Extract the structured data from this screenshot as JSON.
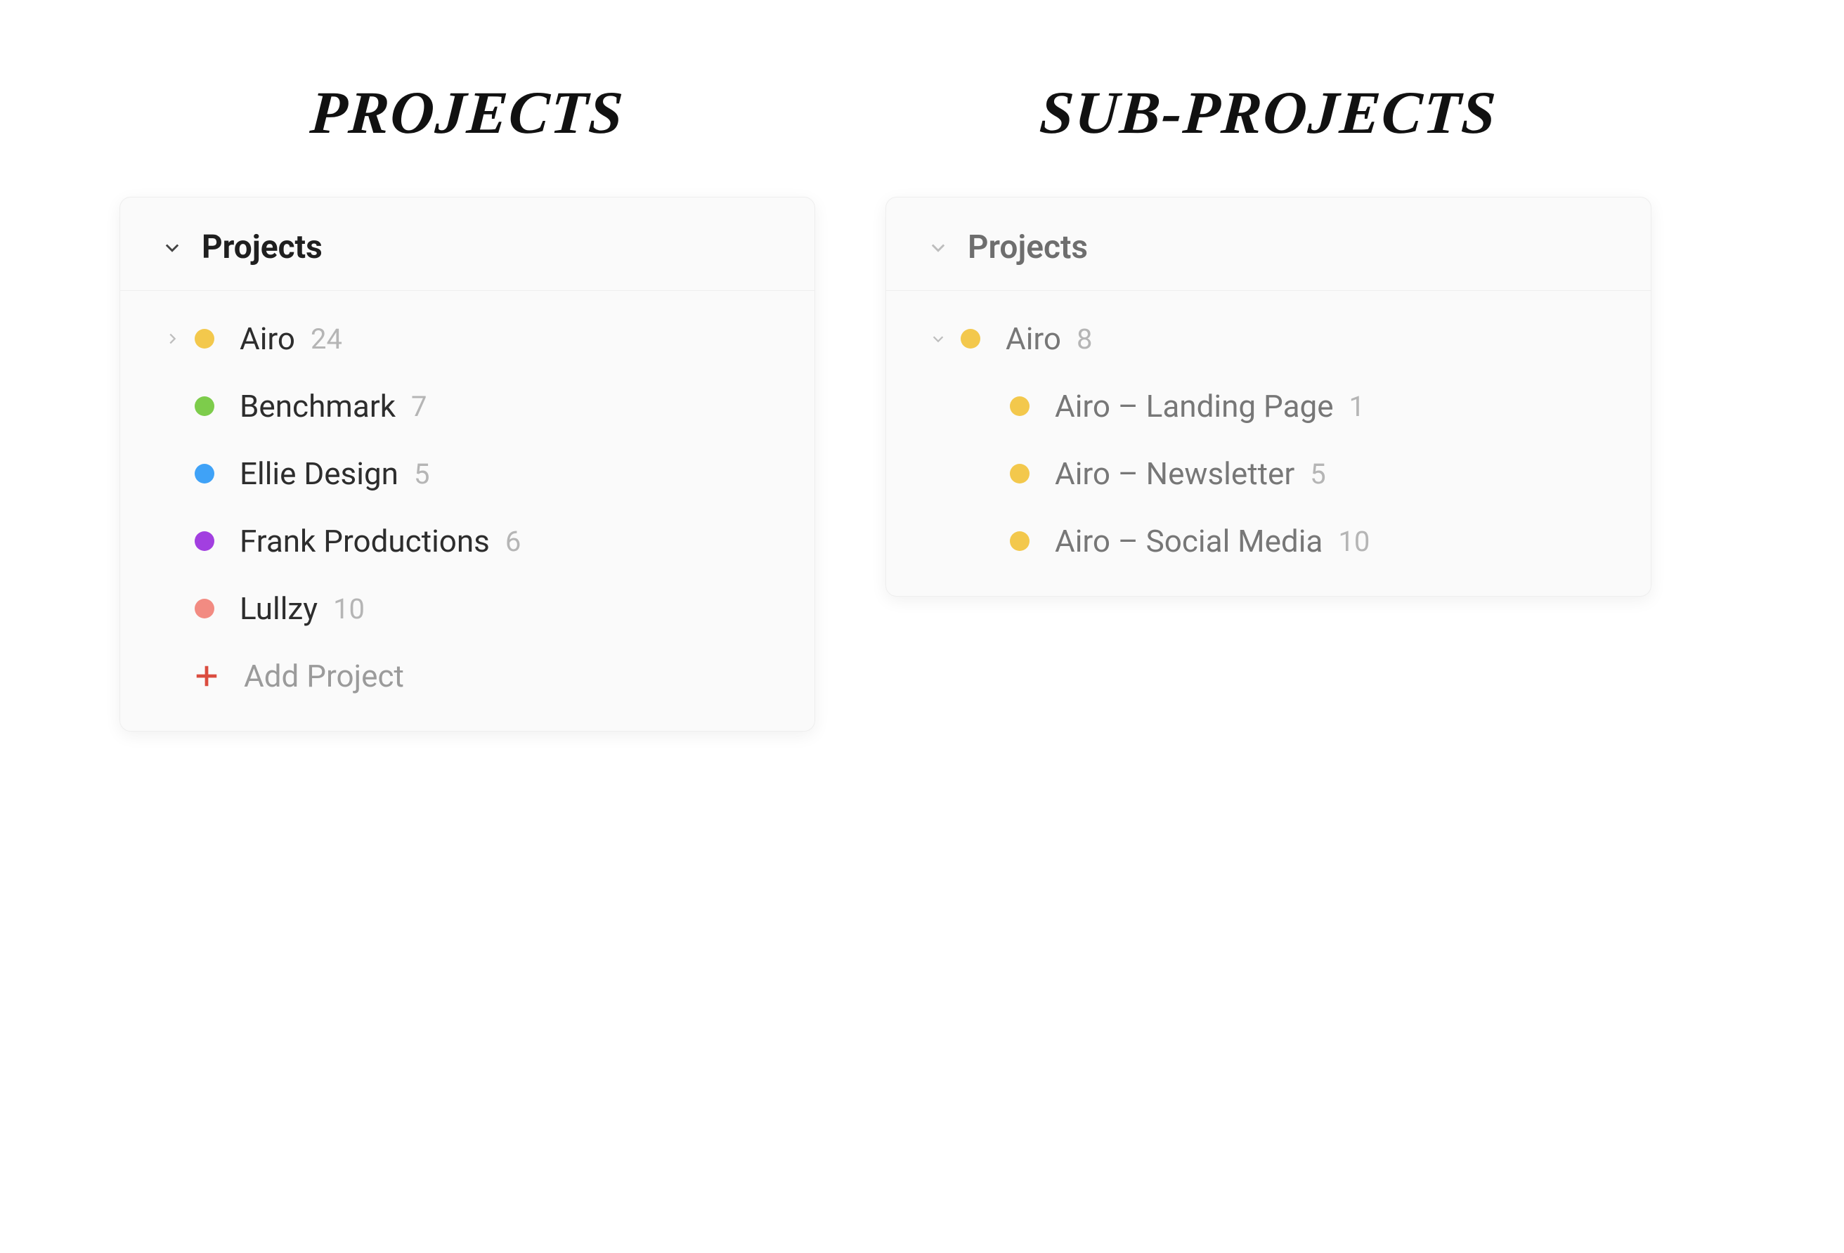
{
  "colors": {
    "yellow": "#f3c84c",
    "green": "#7dcc4b",
    "blue": "#3fa2f7",
    "purple": "#a23fe0",
    "salmon": "#f28b82",
    "accent_red": "#db4c3f"
  },
  "panels": {
    "projects_panel": {
      "heading": "PROJECTS",
      "section_title": "Projects",
      "add_label": "Add Project",
      "items": [
        {
          "label": "Airo",
          "count": 24,
          "color_key": "yellow",
          "expandable": true
        },
        {
          "label": "Benchmark",
          "count": 7,
          "color_key": "green",
          "expandable": false
        },
        {
          "label": "Ellie Design",
          "count": 5,
          "color_key": "blue",
          "expandable": false
        },
        {
          "label": "Frank Productions",
          "count": 6,
          "color_key": "purple",
          "expandable": false
        },
        {
          "label": "Lullzy",
          "count": 10,
          "color_key": "salmon",
          "expandable": false
        }
      ]
    },
    "subprojects_panel": {
      "heading": "SUB-PROJECTS",
      "section_title": "Projects",
      "parent": {
        "label": "Airo",
        "count": 8,
        "color_key": "yellow"
      },
      "children": [
        {
          "label": "Airo – Landing Page",
          "count": 1,
          "color_key": "yellow"
        },
        {
          "label": "Airo – Newsletter",
          "count": 5,
          "color_key": "yellow"
        },
        {
          "label": "Airo – Social Media",
          "count": 10,
          "color_key": "yellow"
        }
      ]
    }
  }
}
